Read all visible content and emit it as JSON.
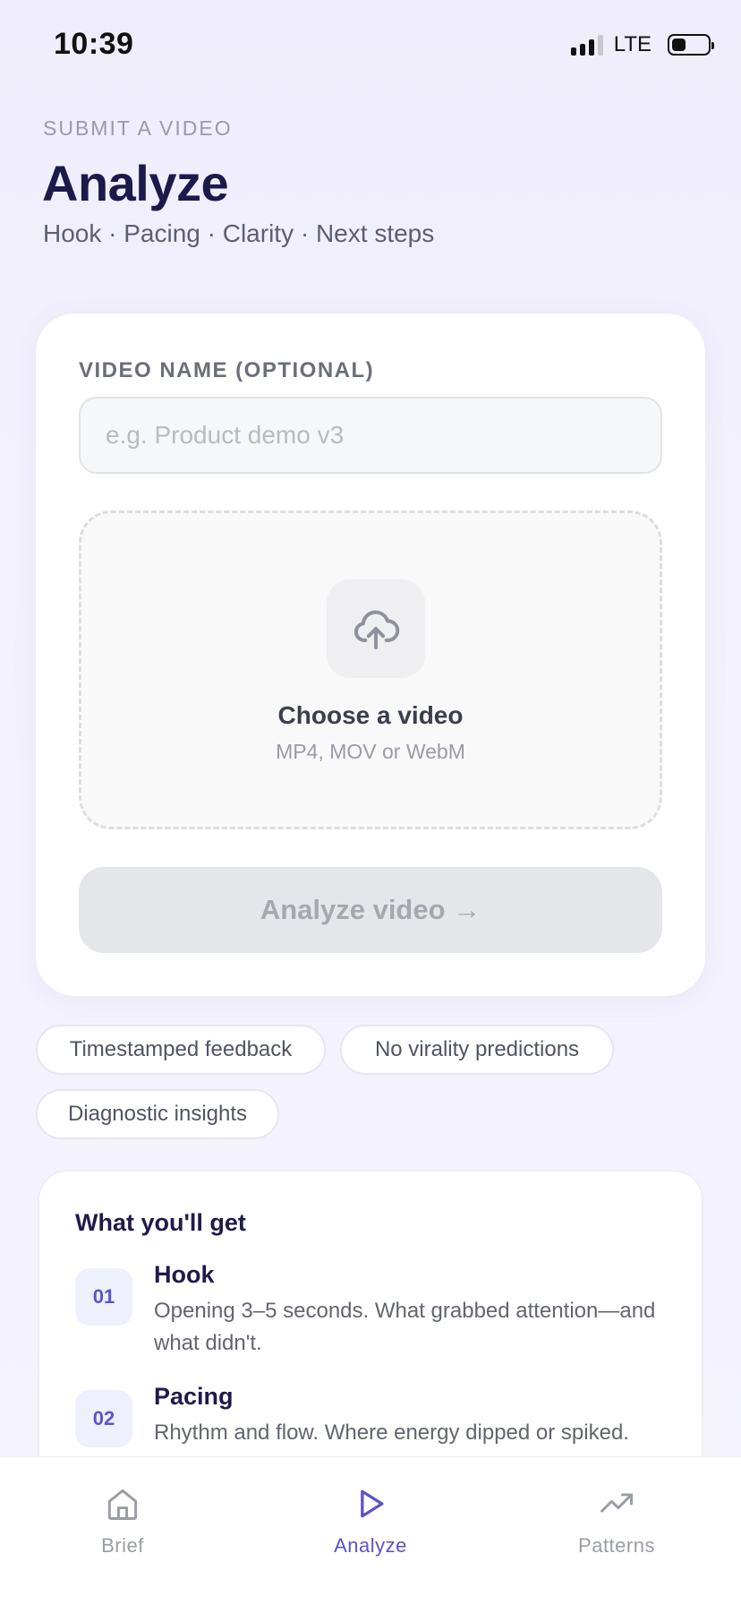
{
  "status_bar": {
    "time": "10:39",
    "network": "LTE"
  },
  "header": {
    "eyebrow": "SUBMIT A VIDEO",
    "title": "Analyze",
    "subtitle": "Hook · Pacing · Clarity · Next steps"
  },
  "form": {
    "name_label": "VIDEO NAME (OPTIONAL)",
    "name_placeholder": "e.g. Product demo v3",
    "name_value": "",
    "upload_icon": "cloud-upload-icon",
    "choose_label": "Choose a video",
    "formats": "MP4, MOV or WebM",
    "analyze_button": "Analyze video →",
    "analyze_disabled": true
  },
  "chips": [
    "Timestamped feedback",
    "No virality predictions",
    "Diagnostic insights"
  ],
  "what_youll_get": {
    "title": "What you'll get",
    "items": [
      {
        "num": "01",
        "title": "Hook",
        "desc": "Opening 3–5 seconds. What grabbed attention—and what didn't."
      },
      {
        "num": "02",
        "title": "Pacing",
        "desc": "Rhythm and flow. Where energy dipped or spiked."
      }
    ]
  },
  "tab_bar": {
    "active": "Analyze",
    "tabs": [
      {
        "label": "Brief",
        "icon": "home-icon"
      },
      {
        "label": "Analyze",
        "icon": "play-icon"
      },
      {
        "label": "Patterns",
        "icon": "trending-up-icon"
      }
    ]
  },
  "colors": {
    "accent": "#5b53c9",
    "title": "#1c1a4a",
    "disabled_bg": "#e5e6ea"
  }
}
